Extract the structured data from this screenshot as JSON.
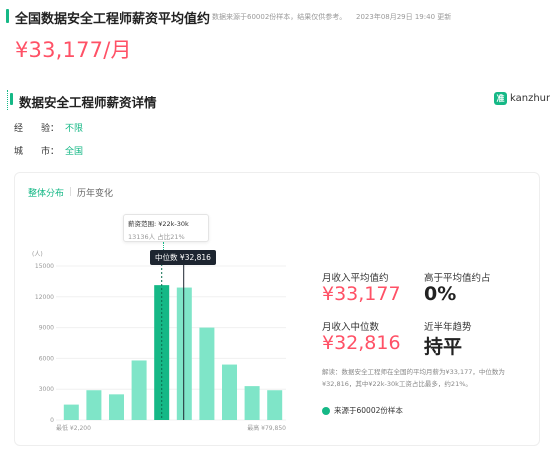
{
  "header": {
    "title": "全国数据安全工程师薪资平均值约",
    "note": "数据来源于60002份样本，结果仅供参考。",
    "updated": "2023年08月29日 19:40 更新",
    "salary": "¥33,177/月"
  },
  "detail": {
    "title": "数据安全工程师薪资详情",
    "logo_icon": "准",
    "logo_text": "kanzhun",
    "filters": [
      {
        "label": "经　　验：",
        "value": "不限"
      },
      {
        "label": "城　　市：",
        "value": "全国"
      }
    ]
  },
  "tabs": [
    {
      "label": "整体分布",
      "active": true
    },
    {
      "label": "历年变化",
      "active": false
    }
  ],
  "tooltip": {
    "range": "薪资范围: ¥22k-30k",
    "count": "13136人 占比21%"
  },
  "median_badge": "中位数 ¥32,816",
  "chart_data": {
    "type": "bar",
    "ylabel": "(人)",
    "ylim": [
      0,
      15000
    ],
    "yticks": [
      "15000",
      "12000",
      "9000",
      "6000",
      "3000",
      "0"
    ],
    "x_min_label": "最低 ¥2,200",
    "x_max_label": "最高 ¥79,850",
    "values": [
      1500,
      2900,
      2500,
      5800,
      13136,
      12900,
      9000,
      5400,
      3300,
      2900
    ],
    "highlight_index": 4,
    "colors": {
      "bar": "#7fe5c8",
      "highlight": "#15b886",
      "median_line": "#1d2530"
    }
  },
  "stats": {
    "avg_label": "月收入平均值约",
    "avg_value": "¥33,177",
    "above_avg_label": "高于平均值约占",
    "above_avg_value": "0%",
    "median_label": "月收入中位数",
    "median_value": "¥32,816",
    "trend_label": "近半年趋势",
    "trend_value": "持平",
    "explain": "解读：数据安全工程师在全国的平均月薪为¥33,177，中位数为¥32,816，其中¥22k-30k工资占比最多，约21%。",
    "source": "来源于60002份样本"
  }
}
